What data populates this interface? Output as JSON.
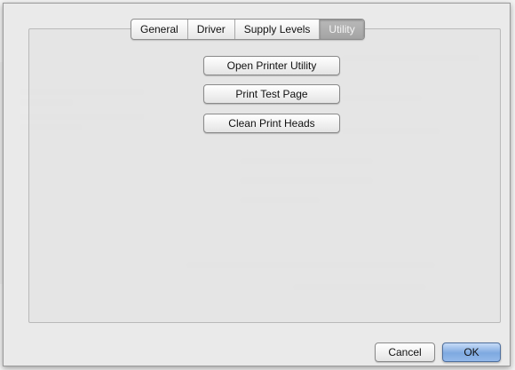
{
  "tabs": [
    {
      "label": "General",
      "selected": false
    },
    {
      "label": "Driver",
      "selected": false
    },
    {
      "label": "Supply Levels",
      "selected": false
    },
    {
      "label": "Utility",
      "selected": true
    }
  ],
  "utility": {
    "open_printer_utility_label": "Open Printer Utility",
    "print_test_page_label": "Print Test Page",
    "clean_print_heads_label": "Clean Print Heads"
  },
  "footer": {
    "cancel_label": "Cancel",
    "ok_label": "OK"
  },
  "colors": {
    "ok_accent": "#7ea9e0",
    "selected_tab": "#a4a4a4"
  }
}
